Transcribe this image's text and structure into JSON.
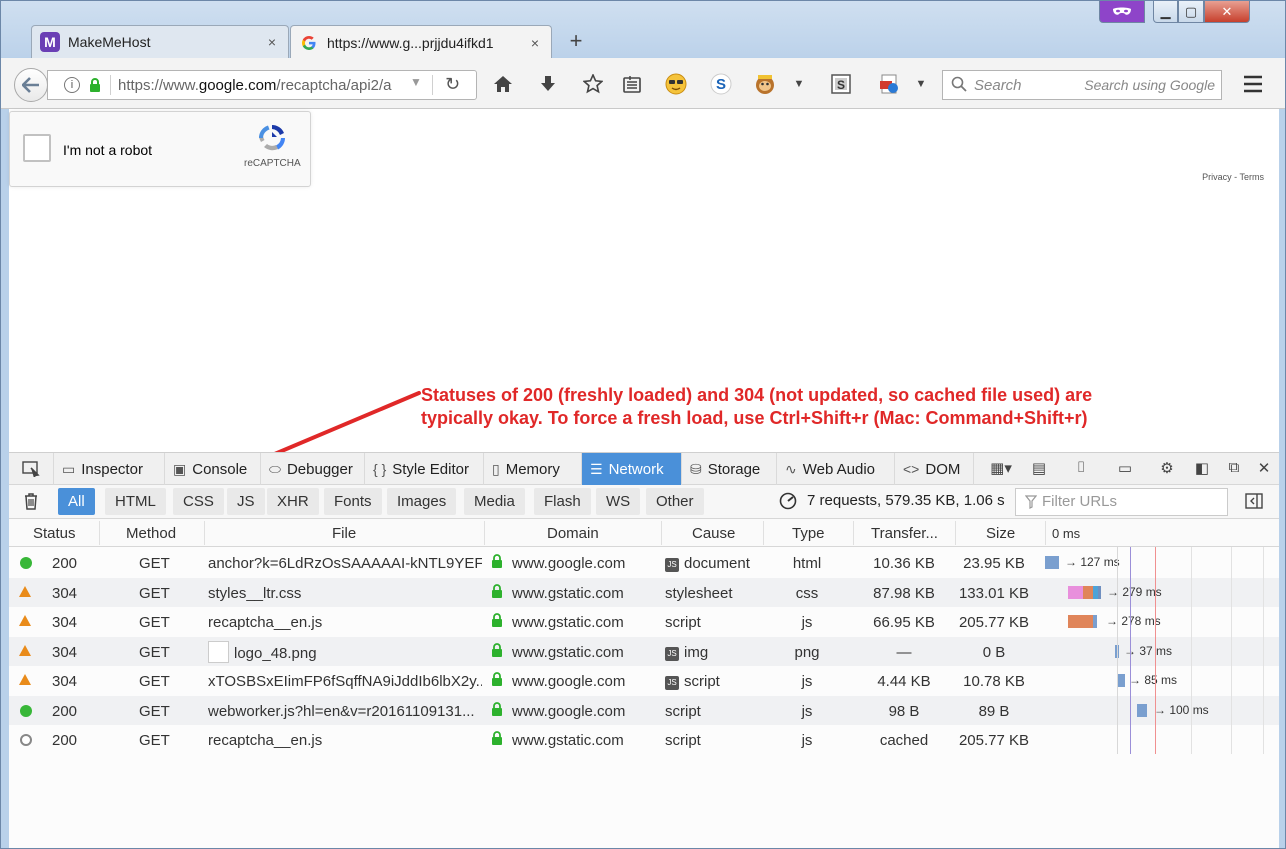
{
  "browser": {
    "tabs": [
      {
        "title": "MakeMeHost",
        "favicon": "makemehost-icon",
        "close": "×"
      },
      {
        "title": "https://www.g...prjjdu4ifkd1",
        "favicon": "google-icon",
        "close": "×"
      }
    ],
    "new_tab": "+",
    "url_prefix": "https://www.",
    "url_domain": "google.com",
    "url_suffix": "/recaptcha/api2/a",
    "search_placeholder": "Search",
    "search_hint": "Search using Google",
    "private_mask_icon": "mask-icon"
  },
  "page": {
    "recaptcha_label": "I'm not a robot",
    "recaptcha_brand": "reCAPTCHA",
    "privacy_terms": "Privacy - Terms"
  },
  "annotation": {
    "line1": "Statuses of 200 (freshly loaded) and 304 (not updated, so cached file used) are",
    "line2": "typically okay. To force a fresh load, use Ctrl+Shift+r (Mac: Command+Shift+r)",
    "color": "#e02828"
  },
  "devtools": {
    "tabs": [
      {
        "label": "Inspector",
        "icon": "inspector-icon"
      },
      {
        "label": "Console",
        "icon": "console-icon"
      },
      {
        "label": "Debugger",
        "icon": "debugger-icon"
      },
      {
        "label": "Style Editor",
        "icon": "style-editor-icon"
      },
      {
        "label": "Memory",
        "icon": "memory-icon"
      },
      {
        "label": "Network",
        "icon": "network-icon",
        "active": true
      },
      {
        "label": "Storage",
        "icon": "storage-icon"
      },
      {
        "label": "Web Audio",
        "icon": "web-audio-icon"
      },
      {
        "label": "DOM",
        "icon": "dom-icon"
      }
    ],
    "accent": "#4a90d9",
    "filters": [
      "All",
      "HTML",
      "CSS",
      "JS",
      "XHR",
      "Fonts",
      "Images",
      "Media",
      "Flash",
      "WS",
      "Other"
    ],
    "summary": "7 requests, 579.35 KB, 1.06 s",
    "filter_placeholder": "Filter URLs",
    "columns": {
      "status": "Status",
      "method": "Method",
      "file": "File",
      "domain": "Domain",
      "cause": "Cause",
      "type": "Type",
      "transferred": "Transfer...",
      "size": "Size",
      "timeline": "0 ms"
    },
    "rows": [
      {
        "indicator": "green-dot",
        "status": "200",
        "method": "GET",
        "file": "anchor?k=6LdRzOsSAAAAAI-kNTL9YEF...",
        "domain": "www.google.com",
        "cause": "document",
        "cause_js": true,
        "type": "html",
        "transferred": "10.36 KB",
        "size": "23.95 KB",
        "timing": "→ 127 ms"
      },
      {
        "indicator": "orange-triangle",
        "status": "304",
        "method": "GET",
        "file": "styles__ltr.css",
        "domain": "www.gstatic.com",
        "cause": "stylesheet",
        "cause_js": false,
        "type": "css",
        "transferred": "87.98 KB",
        "size": "133.01 KB",
        "timing": "→ 279 ms"
      },
      {
        "indicator": "orange-triangle",
        "status": "304",
        "method": "GET",
        "file": "recaptcha__en.js",
        "domain": "www.gstatic.com",
        "cause": "script",
        "cause_js": false,
        "type": "js",
        "transferred": "66.95 KB",
        "size": "205.77 KB",
        "timing": "→ 278 ms"
      },
      {
        "indicator": "orange-triangle",
        "status": "304",
        "method": "GET",
        "file": "logo_48.png",
        "domain": "www.gstatic.com",
        "cause": "img",
        "cause_js": true,
        "type": "png",
        "transferred": "—",
        "size": "0 B",
        "timing": "→ 37 ms",
        "thumbnail": true
      },
      {
        "indicator": "orange-triangle",
        "status": "304",
        "method": "GET",
        "file": "xTOSBSxEIimFP6fSqffNA9iJddIb6lbX2y...",
        "domain": "www.google.com",
        "cause": "script",
        "cause_js": true,
        "type": "js",
        "transferred": "4.44 KB",
        "size": "10.78 KB",
        "timing": "→ 85 ms"
      },
      {
        "indicator": "green-dot",
        "status": "200",
        "method": "GET",
        "file": "webworker.js?hl=en&v=r20161109131...",
        "domain": "www.google.com",
        "cause": "script",
        "cause_js": false,
        "type": "js",
        "transferred": "98 B",
        "size": "89 B",
        "timing": "→ 100 ms"
      },
      {
        "indicator": "hollow-dot",
        "status": "200",
        "method": "GET",
        "file": "recaptcha__en.js",
        "domain": "www.gstatic.com",
        "cause": "script",
        "cause_js": false,
        "type": "js",
        "transferred": "cached",
        "size": "205.77 KB",
        "timing": ""
      }
    ]
  }
}
